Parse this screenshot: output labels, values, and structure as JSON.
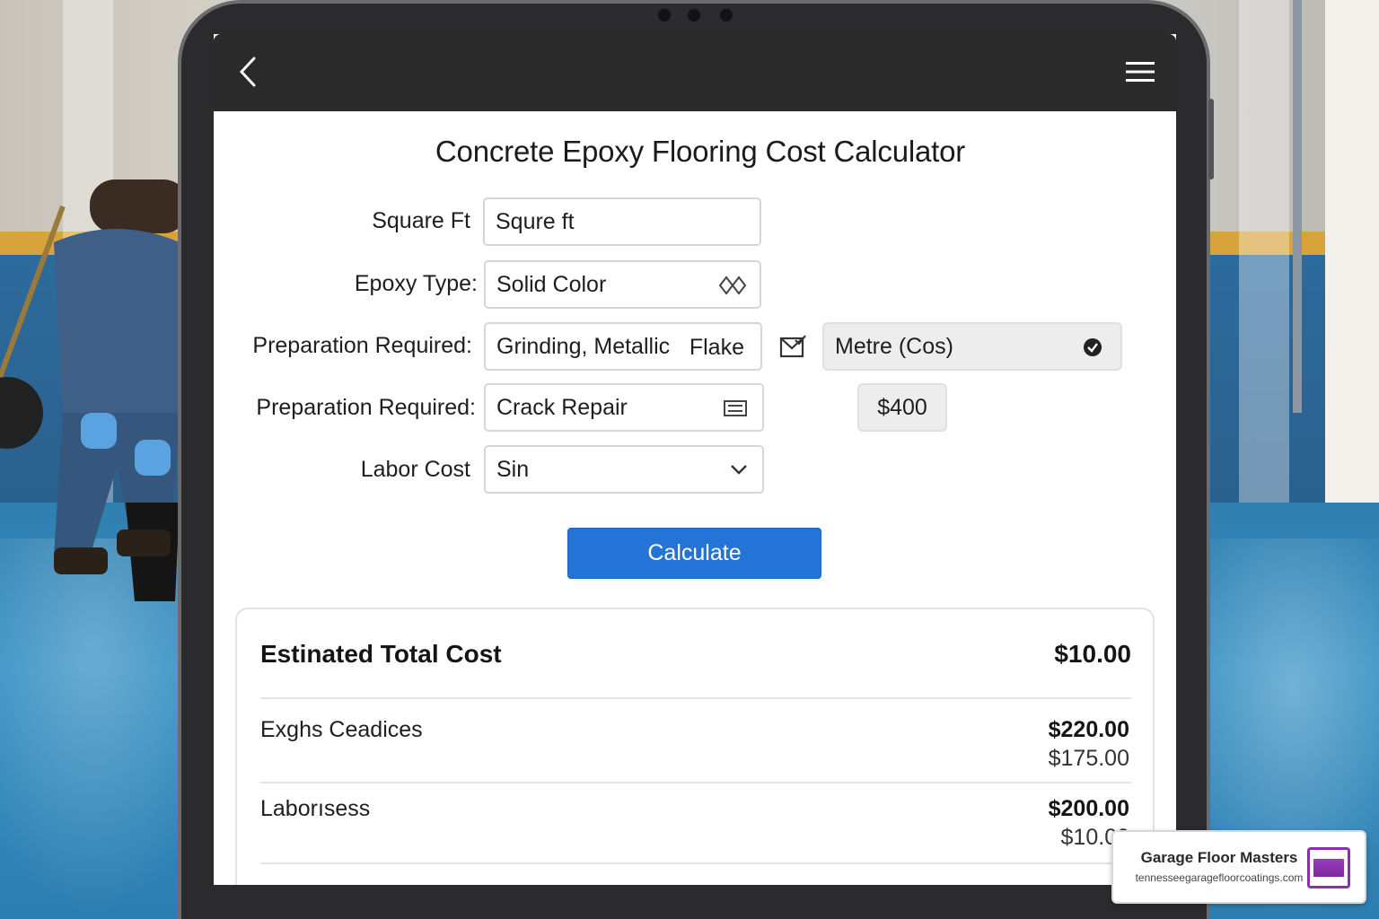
{
  "app": {
    "title": "Concrete Epoxy Flooring Cost Calculator"
  },
  "form": {
    "square_ft": {
      "label": "Square Ft",
      "value": "Squre ft"
    },
    "epoxy_type": {
      "label": "Epoxy Type:",
      "value": "Solid Color"
    },
    "preparation_1": {
      "label": "Preparation Required:",
      "value": "Grinding, Metallic",
      "value_suffix": "Flake"
    },
    "unit_select": {
      "value": "Metre (Cos)"
    },
    "preparation_2": {
      "label": "Preparation Required:",
      "value": "Crack Repair"
    },
    "prep_cost": {
      "value": "$400"
    },
    "labor_cost": {
      "label": "Labor Cost",
      "value": "Sin"
    },
    "calculate_label": "Calculate"
  },
  "results": {
    "title": "Estinated Total Cost",
    "total": "$10.00",
    "rows": [
      {
        "label": "Exghs Ceadices",
        "main": "$220.00",
        "sub": "$175.00"
      },
      {
        "label": "Laborısess",
        "main": "$200.00",
        "sub": "$10.00"
      }
    ]
  },
  "brand": {
    "name": "Garage Floor Masters",
    "url": "tennesseegaragefloorcoatings.com"
  },
  "icons": {
    "back": "chevron-left-icon",
    "menu": "hamburger-menu-icon",
    "epoxy_picker": "diamond-pattern-icon",
    "mail": "envelope-check-icon",
    "check": "check-circle-icon",
    "prep_picker": "list-icon",
    "dropdown": "chevron-down-icon"
  },
  "colors": {
    "topbar": "#2a2a2a",
    "accent_button": "#2374d6",
    "brand_logo": "#8a2fb0"
  }
}
